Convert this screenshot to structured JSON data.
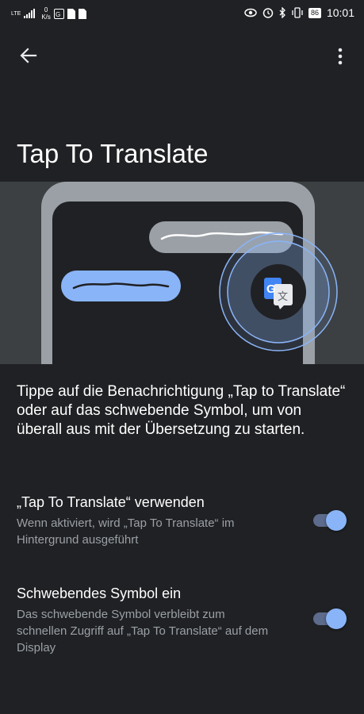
{
  "status_bar": {
    "network": "LTE",
    "speed_value": "0",
    "speed_unit": "K/s",
    "battery": "86",
    "time": "10:01"
  },
  "toolbar": {
    "back_icon": "arrow-left-icon",
    "menu_icon": "more-vert-icon"
  },
  "page": {
    "title": "Tap To Translate",
    "description": "Tippe auf die Benachrichtigung „Tap to Translate“ oder auf das schwebende Symbol, um von überall aus mit der Übersetzung zu starten."
  },
  "settings": [
    {
      "title": "„Tap To Translate“ verwenden",
      "subtitle": "Wenn aktiviert, wird „Tap To Translate“ im Hintergrund ausgeführt",
      "enabled": true
    },
    {
      "title": "Schwebendes Symbol ein",
      "subtitle": "Das schwebende Symbol verbleibt zum schnellen Zugriff auf „Tap To Translate“ auf dem Display",
      "enabled": true
    }
  ],
  "colors": {
    "background": "#202124",
    "accent": "#8ab4f8",
    "illustration_bg": "#3c4043",
    "phone_frame": "#9aa0a6",
    "left_bubble": "#8ab4f8",
    "right_bubble": "#9aa0a6"
  },
  "illustration": {
    "icons": [
      "google-translate-icon"
    ],
    "glyph_g": "G",
    "glyph_translate": "文"
  }
}
